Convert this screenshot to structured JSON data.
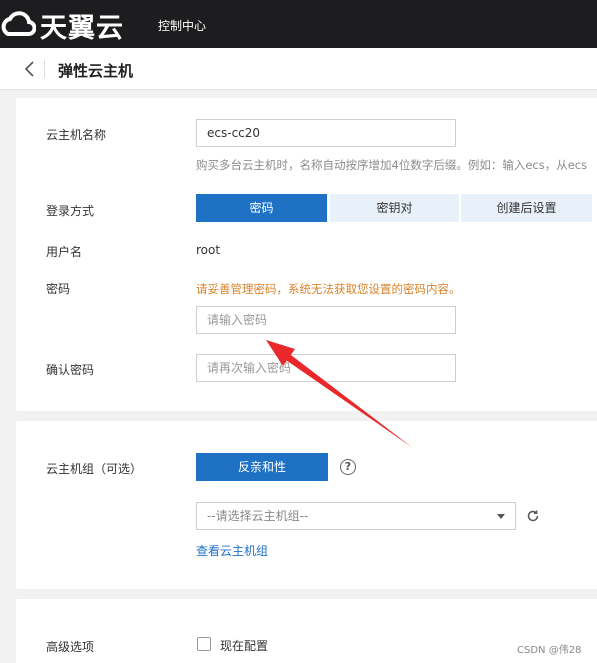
{
  "topbar": {
    "brand": "天翼云",
    "nav_console": "控制中心"
  },
  "header": {
    "title": "弹性云主机"
  },
  "form": {
    "name_label": "云主机名称",
    "name_value": "ecs-cc20",
    "name_hint": "购买多台云主机时，名称自动按序增加4位数字后缀。例如：输入ecs，从ecs",
    "login_label": "登录方式",
    "login_options": [
      "密码",
      "密钥对",
      "创建后设置"
    ],
    "username_label": "用户名",
    "username_value": "root",
    "password_label": "密码",
    "password_warning": "请妥善管理密码，系统无法获取您设置的密码内容。",
    "password_placeholder": "请输入密码",
    "confirm_label": "确认密码",
    "confirm_placeholder": "请再次输入密码"
  },
  "group": {
    "label": "云主机组（可选）",
    "affinity_button": "反亲和性",
    "help_symbol": "?",
    "select_placeholder": "--请选择云主机组--",
    "view_link": "查看云主机组"
  },
  "advanced": {
    "label": "高级选项",
    "configure_now": "现在配置"
  },
  "watermark": "CSDN @伟28",
  "colors": {
    "primary": "#1f71c6",
    "warning": "#d9822b",
    "annotation_arrow": "#e8282b",
    "topbar": "#1d1d1f"
  }
}
